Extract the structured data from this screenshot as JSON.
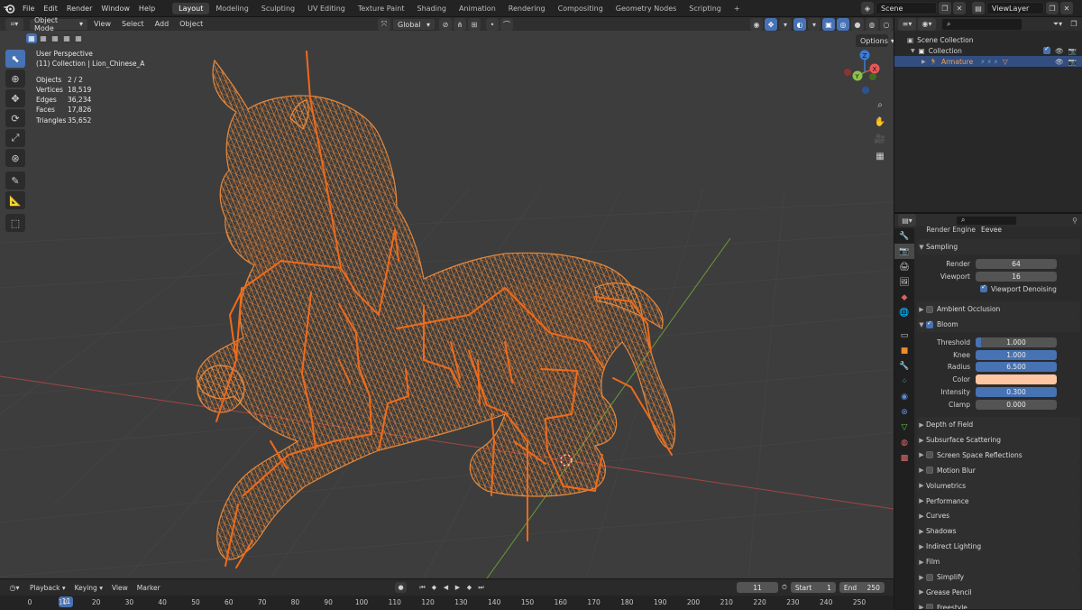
{
  "topbar": {
    "menus": [
      "File",
      "Edit",
      "Render",
      "Window",
      "Help"
    ],
    "workspaces": [
      "Layout",
      "Modeling",
      "Sculpting",
      "UV Editing",
      "Texture Paint",
      "Shading",
      "Animation",
      "Rendering",
      "Compositing",
      "Geometry Nodes",
      "Scripting"
    ],
    "active_workspace": "Layout",
    "add_tab": "+",
    "scene": "Scene",
    "view_layer": "ViewLayer"
  },
  "viewport_header": {
    "mode": "Object Mode",
    "menus": [
      "View",
      "Select",
      "Add",
      "Object"
    ],
    "orientation": "Global",
    "options": "Options"
  },
  "overlay": {
    "view_name": "User Perspective",
    "collection_info": "(11) Collection | Lion_Chinese_A",
    "stats": [
      {
        "key": "Objects",
        "value": "2 / 2"
      },
      {
        "key": "Vertices",
        "value": "18,519"
      },
      {
        "key": "Edges",
        "value": "36,234"
      },
      {
        "key": "Faces",
        "value": "17,826"
      },
      {
        "key": "Triangles",
        "value": "35,652"
      }
    ]
  },
  "gizmo": {
    "x": "X",
    "y": "Y",
    "z": "Z"
  },
  "outliner": {
    "root": "Scene Collection",
    "collection": "Collection",
    "armature": "Armature"
  },
  "properties": {
    "render_engine_label": "Render Engine",
    "render_engine_value": "Eevee",
    "sampling": {
      "title": "Sampling",
      "render_label": "Render",
      "render_value": "64",
      "viewport_label": "Viewport",
      "viewport_value": "16",
      "denoise_label": "Viewport Denoising"
    },
    "ambient_occlusion": "Ambient Occlusion",
    "bloom": {
      "title": "Bloom",
      "threshold_label": "Threshold",
      "threshold_value": "1.000",
      "knee_label": "Knee",
      "knee_value": "1.000",
      "radius_label": "Radius",
      "radius_value": "6.500",
      "color_label": "Color",
      "color_hex": "#ffc6a3",
      "intensity_label": "Intensity",
      "intensity_value": "0.300",
      "clamp_label": "Clamp",
      "clamp_value": "0.000"
    },
    "collapsed_panels": [
      {
        "label": "Depth of Field",
        "checkbox": false
      },
      {
        "label": "Subsurface Scattering",
        "checkbox": false
      },
      {
        "label": "Screen Space Reflections",
        "checkbox": true
      },
      {
        "label": "Motion Blur",
        "checkbox": true
      },
      {
        "label": "Volumetrics",
        "checkbox": false
      },
      {
        "label": "Performance",
        "checkbox": false
      },
      {
        "label": "Curves",
        "checkbox": false
      },
      {
        "label": "Shadows",
        "checkbox": false
      },
      {
        "label": "Indirect Lighting",
        "checkbox": false
      },
      {
        "label": "Film",
        "checkbox": false
      },
      {
        "label": "Simplify",
        "checkbox": true
      },
      {
        "label": "Grease Pencil",
        "checkbox": false
      },
      {
        "label": "Freestyle",
        "checkbox": true
      }
    ]
  },
  "timeline": {
    "menus": [
      "Playback",
      "Keying",
      "View",
      "Marker"
    ],
    "current_frame": "11",
    "start_label": "Start",
    "start_value": "1",
    "end_label": "End",
    "end_value": "250",
    "ticks": [
      "0",
      "10",
      "20",
      "30",
      "40",
      "50",
      "60",
      "70",
      "80",
      "90",
      "100",
      "110",
      "120",
      "130",
      "140",
      "150",
      "160",
      "170",
      "180",
      "190",
      "200",
      "210",
      "220",
      "230",
      "240",
      "250"
    ]
  },
  "colors": {
    "accent": "#4772b3",
    "wire": "#e8883a",
    "bone": "#f06a1a",
    "selection": "#334d80"
  }
}
